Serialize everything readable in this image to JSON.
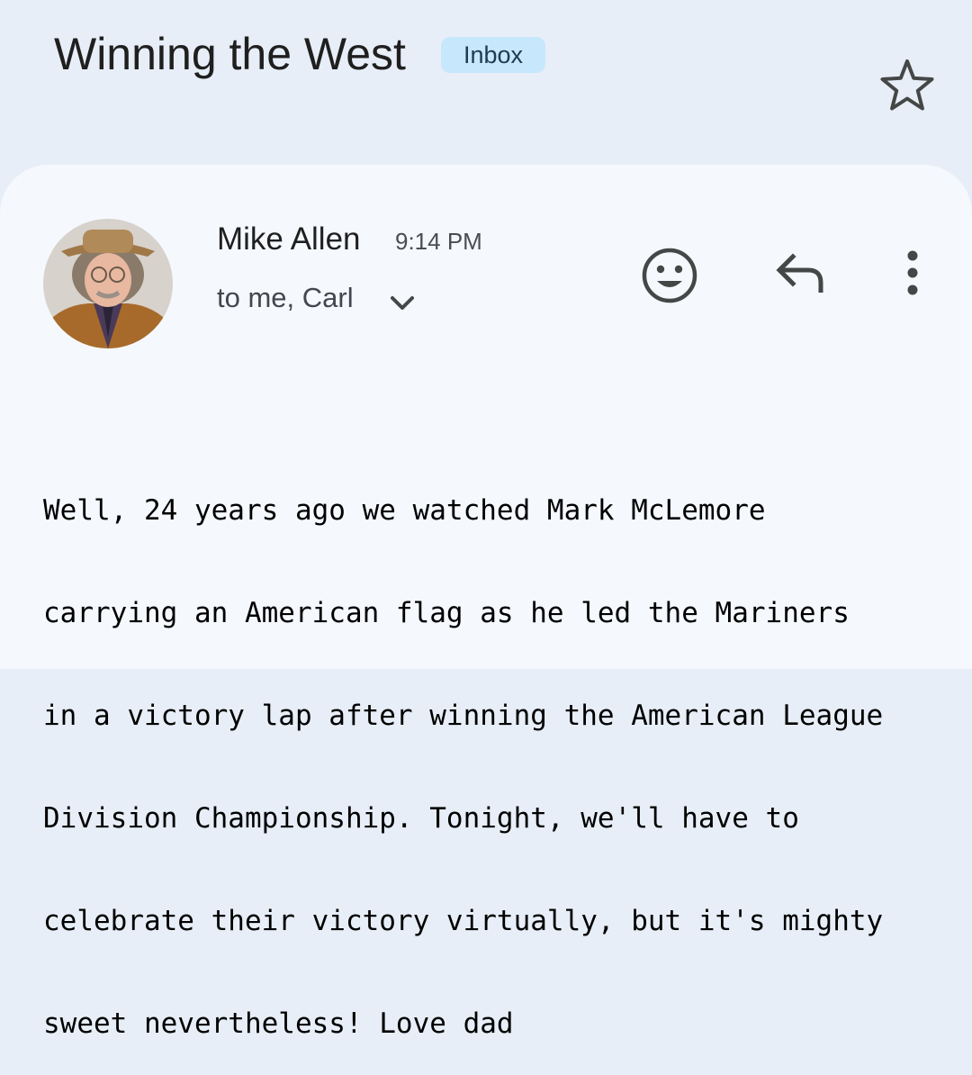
{
  "header": {
    "subject": "Winning the West",
    "label": "Inbox"
  },
  "message": {
    "sender_name": "Mike Allen",
    "time": "9:14 PM",
    "recipients": "to me, Carl",
    "body_lines": [
      "Well, 24 years ago we watched Mark McLemore",
      "carrying an American flag as he led the Mariners",
      "in a victory lap after winning the American League",
      "Division Championship. Tonight, we'll have to",
      "celebrate their victory virtually, but it's mighty",
      "sweet nevertheless! Love dad"
    ]
  },
  "icons": {
    "star": "star-outline-icon",
    "expand": "chevron-down-icon",
    "emoji": "emoji-reaction-icon",
    "reply": "reply-icon",
    "more": "more-vert-icon"
  },
  "colors": {
    "background": "#e7eef7",
    "card": "#f5f8fd",
    "label_chip": "#c7e7fc",
    "icon": "#444746"
  }
}
